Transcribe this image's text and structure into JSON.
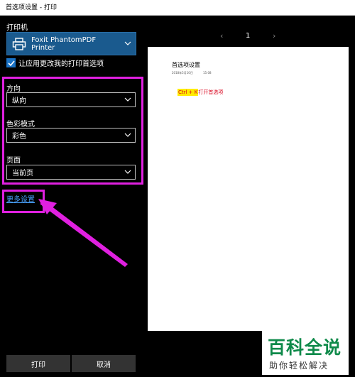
{
  "window": {
    "title": "首选项设置 - 打印"
  },
  "printer": {
    "label": "打印机",
    "selected": "Foxit PhantomPDF Printer"
  },
  "checkbox": {
    "label": "让应用更改我的打印首选项",
    "checked": true
  },
  "orientation": {
    "label": "方向",
    "value": "纵向"
  },
  "color_mode": {
    "label": "色彩模式",
    "value": "彩色"
  },
  "pages": {
    "label": "页面",
    "value": "当前页"
  },
  "more_settings": {
    "label": "更多设置"
  },
  "buttons": {
    "print": "打印",
    "cancel": "取消"
  },
  "preview": {
    "page_number": "1",
    "prev_arrow": "‹",
    "next_arrow": "›",
    "doc_title": "首选项设置",
    "doc_date": "2018年5月10日",
    "doc_time": "15:08",
    "shortcut": "Ctrl + K",
    "shortcut_desc": "打开首选项"
  },
  "watermark": {
    "main": "百科全说",
    "sub": "助你轻松解决"
  },
  "colors": {
    "accent": "#1a73c6",
    "highlight": "#e020e0",
    "link": "#4aa3ff",
    "printer_box": "#1a5a8e"
  }
}
